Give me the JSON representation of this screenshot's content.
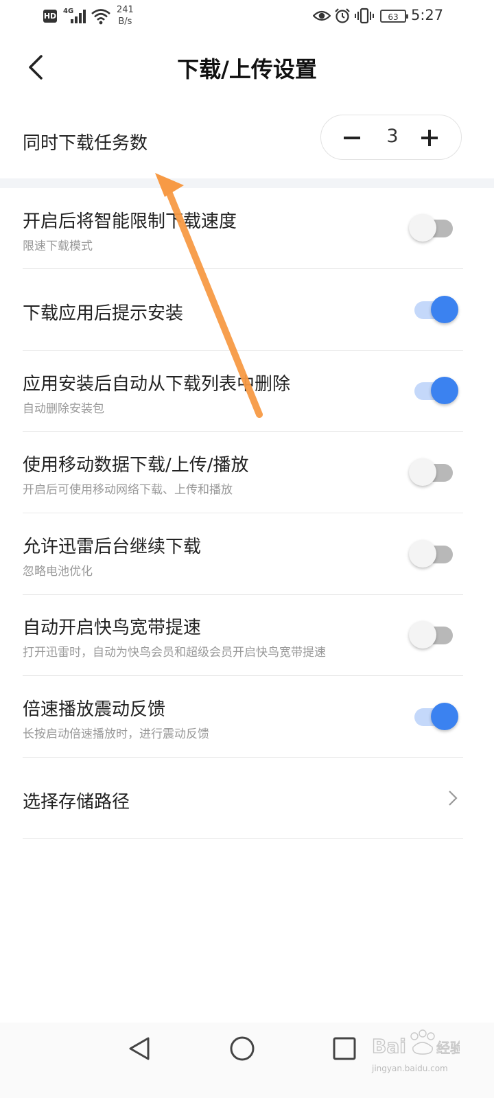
{
  "status_bar": {
    "hd": "HD",
    "network": "4G",
    "speed_value": "241",
    "speed_unit": "B/s",
    "battery": "63",
    "time": "5:27"
  },
  "header": {
    "title": "下载/上传设置"
  },
  "concurrent": {
    "label": "同时下载任务数",
    "value": "3"
  },
  "settings": [
    {
      "title": "开启后将智能限制下载速度",
      "subtitle": "限速下载模式",
      "enabled": false
    },
    {
      "title": "下载应用后提示安装",
      "subtitle": "",
      "enabled": true
    },
    {
      "title": "应用安装后自动从下载列表中删除",
      "subtitle": "自动删除安装包",
      "enabled": true
    },
    {
      "title": "使用移动数据下载/上传/播放",
      "subtitle": "开启后可使用移动网络下载、上传和播放",
      "enabled": false
    },
    {
      "title": "允许迅雷后台继续下载",
      "subtitle": "忽略电池优化",
      "enabled": false
    },
    {
      "title": "自动开启快鸟宽带提速",
      "subtitle": "打开迅雷时，自动为快鸟会员和超级会员开启快鸟宽带提速",
      "enabled": false
    },
    {
      "title": "倍速播放震动反馈",
      "subtitle": "长按启动倍速播放时，进行震动反馈",
      "enabled": true
    }
  ],
  "storage": {
    "label": "选择存储路径"
  },
  "colors": {
    "accent": "#3b82f0",
    "annotation_arrow": "#f79a45"
  },
  "watermark": {
    "logo": "Baidu经验",
    "url": "jingyan.baidu.com"
  }
}
